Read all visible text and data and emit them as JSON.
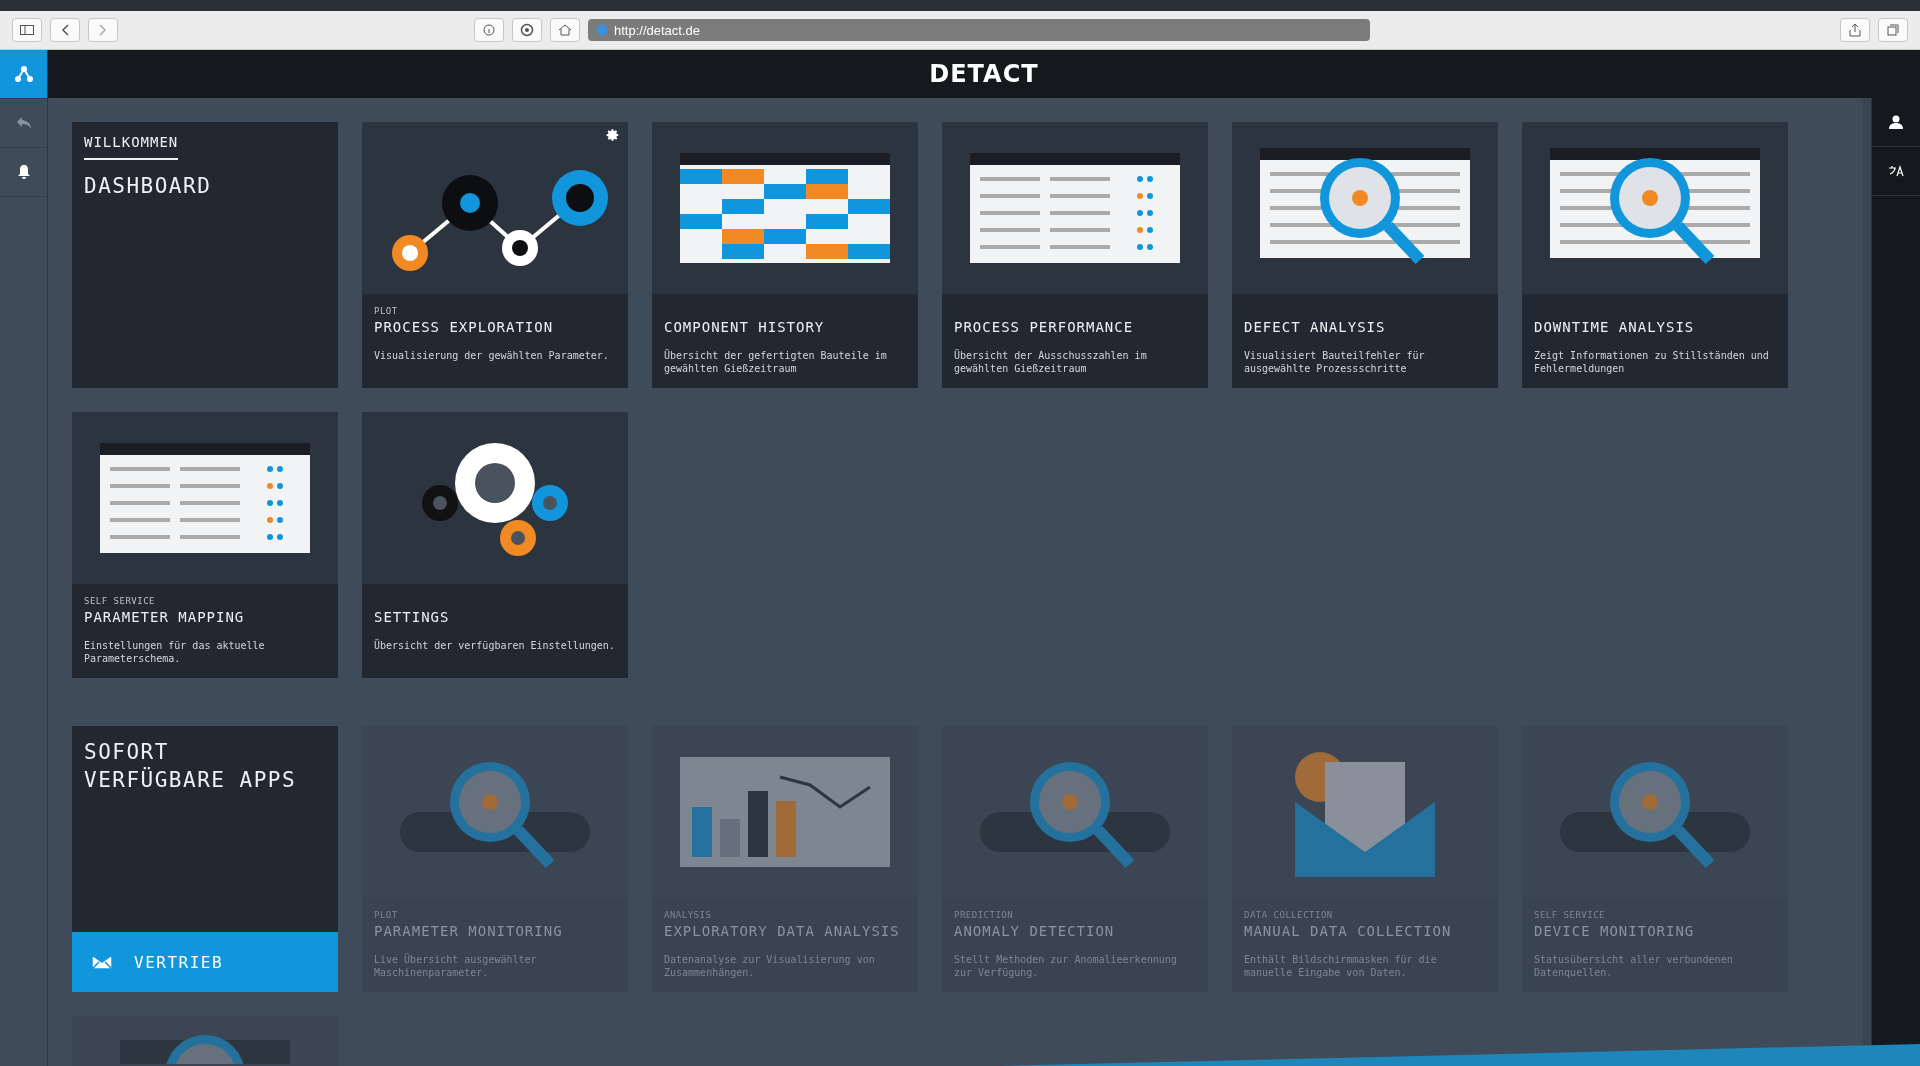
{
  "browser": {
    "url": "http://detact.de"
  },
  "header": {
    "logo": "DETACT"
  },
  "sidebar": {
    "items": [
      {
        "kind": "network",
        "selected": true
      },
      {
        "kind": "back",
        "selected": false
      },
      {
        "kind": "bell",
        "selected": false
      }
    ]
  },
  "welcome": {
    "eyebrow": "WILLKOMMEN",
    "title": "DASHBOARD"
  },
  "apps": [
    {
      "kind": "plot",
      "category": "PLOT",
      "title": "PROCESS EXPLORATION",
      "description": "Visualisierung der gewählten Parameter.",
      "settings": true
    },
    {
      "kind": "grid",
      "title": "COMPONENT HISTORY",
      "description": "Übersicht der gefertigten Bauteile im gewählten Gießzeitraum",
      "settings": false
    },
    {
      "kind": "list",
      "title": "PROCESS PERFORMANCE",
      "description": "Übersicht der Ausschusszahlen im gewählten Gießzeitraum",
      "settings": false
    },
    {
      "kind": "defect",
      "title": "DEFECT ANALYSIS",
      "description": "Visualisiert Bauteilfehler für ausgewählte Prozessschritte",
      "settings": false
    },
    {
      "kind": "downtime",
      "title": "DOWNTIME ANALYSIS",
      "description": "Zeigt Informationen zu Stillständen und Fehlermeldungen",
      "settings": false
    },
    {
      "kind": "mapping",
      "category": "SELF SERVICE",
      "title": "PARAMETER MAPPING",
      "description": "Einstellungen für das aktuelle Parameterschema.",
      "settings": false
    },
    {
      "kind": "gears",
      "title": "SETTINGS",
      "description": "Übersicht der verfügbaren Einstellungen.",
      "settings": false
    }
  ],
  "available": {
    "title_lines": [
      "SOFORT",
      "VERFÜGBARE APPS"
    ],
    "button": "VERTRIEB",
    "apps": [
      {
        "kind": "monitor",
        "category": "PLOT",
        "title": "PARAMETER MONITORING",
        "description": "Live Übersicht ausgewählter Maschinenparameter."
      },
      {
        "kind": "eda",
        "category": "ANALYSIS",
        "title": "EXPLORATORY DATA ANALYSIS",
        "description": "Datenanalyse zur Visualisierung von Zusammenhängen."
      },
      {
        "kind": "anomaly",
        "category": "PREDICTION",
        "title": "ANOMALY DETECTION",
        "description": "Stellt Methoden zur Anomalieerkennung zur Verfügung."
      },
      {
        "kind": "collection",
        "category": "DATA COLLECTION",
        "title": "MANUAL DATA COLLECTION",
        "description": "Enthält Bildschirmmasken für die manuelle Eingabe von Daten."
      },
      {
        "kind": "device",
        "category": "SELF SERVICE",
        "title": "DEVICE MONITORING",
        "description": "Statusübersicht aller verbundenen Datenquellen."
      },
      {
        "kind": "partial"
      }
    ]
  }
}
